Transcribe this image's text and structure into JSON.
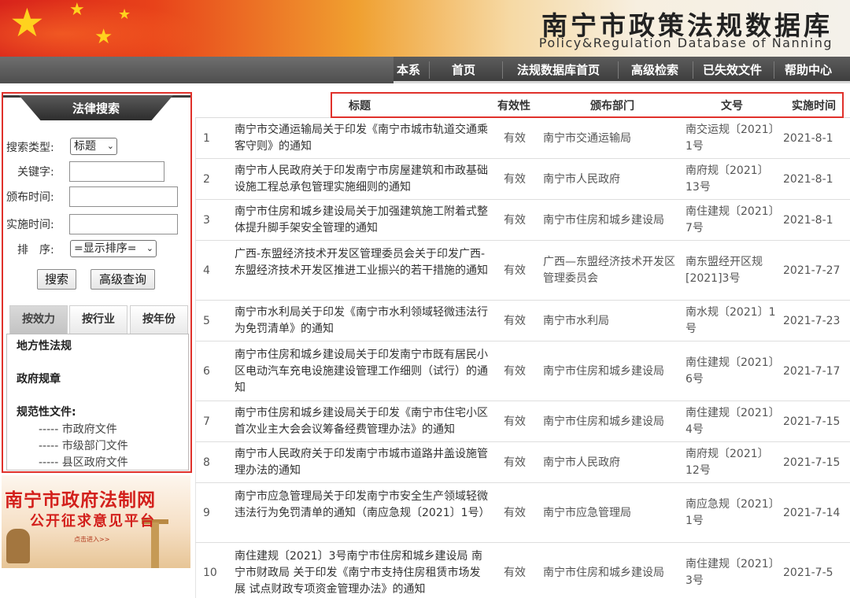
{
  "site": {
    "title": "南宁市政策法规数据库",
    "subtitle": "Policy&Regulation Database of Nanning"
  },
  "nav": {
    "partial": "本系",
    "items": [
      "首页",
      "法规数据库首页",
      "高级检索",
      "已失效文件",
      "帮助中心"
    ]
  },
  "search_panel": {
    "header": "法律搜索",
    "type_label": "搜索类型:",
    "type_value": "标题",
    "keyword_label": "关键字:",
    "keyword_value": "",
    "publish_label": "颁布时间:",
    "publish_value": "",
    "effective_label": "实施时间:",
    "effective_value": "",
    "sort_label": "排　序:",
    "sort_value": "=显示排序=",
    "search_button": "搜索",
    "advanced_button": "高级查询"
  },
  "tabs": [
    {
      "label": "按效力",
      "active": true
    },
    {
      "label": "按行业",
      "active": false
    },
    {
      "label": "按年份",
      "active": false
    }
  ],
  "categories": {
    "local_laws": "地方性法规",
    "gov_rules": "政府规章",
    "normative": "规范性文件:",
    "links": [
      "----- 市政府文件",
      "----- 市级部门文件",
      "----- 县区政府文件"
    ]
  },
  "promo": {
    "title": "南宁市政府法制网",
    "subtitle": "公开征求意见平台",
    "enter": "点击进入>>"
  },
  "table": {
    "headers": {
      "title": "标题",
      "validity": "有效性",
      "dept": "颁布部门",
      "doc_no": "文号",
      "date": "实施时间"
    },
    "rows": [
      {
        "idx": "1",
        "title": "南宁市交通运输局关于印发《南宁市城市轨道交通乘客守则》的通知",
        "validity": "有效",
        "dept": "南宁市交通运输局",
        "doc_no": "南交运规〔2021〕1号",
        "date": "2021-8-1"
      },
      {
        "idx": "2",
        "title": "南宁市人民政府关于印发南宁市房屋建筑和市政基础设施工程总承包管理实施细则的通知",
        "validity": "有效",
        "dept": "南宁市人民政府",
        "doc_no": "南府规〔2021〕13号",
        "date": "2021-8-1"
      },
      {
        "idx": "3",
        "title": "南宁市住房和城乡建设局关于加强建筑施工附着式整体提升脚手架安全管理的通知",
        "validity": "有效",
        "dept": "南宁市住房和城乡建设局",
        "doc_no": "南住建规〔2021〕7号",
        "date": "2021-8-1"
      },
      {
        "idx": "4",
        "title": "广西-东盟经济技术开发区管理委员会关于印发广西-东盟经济技术开发区推进工业振兴的若干措施的通知",
        "validity": "有效",
        "dept": "广西—东盟经济技术开发区管理委员会",
        "doc_no": "南东盟经开区规[2021]3号",
        "date": "2021-7-27"
      },
      {
        "idx": "5",
        "title": "南宁市水利局关于印发《南宁市水利领域轻微违法行为免罚清单》的通知",
        "validity": "有效",
        "dept": "南宁市水利局",
        "doc_no": "南水规〔2021〕1号",
        "date": "2021-7-23"
      },
      {
        "idx": "6",
        "title": "南宁市住房和城乡建设局关于印发南宁市既有居民小区电动汽车充电设施建设管理工作细则（试行）的通知",
        "validity": "有效",
        "dept": "南宁市住房和城乡建设局",
        "doc_no": "南住建规〔2021〕6号",
        "date": "2021-7-17"
      },
      {
        "idx": "7",
        "title": "南宁市住房和城乡建设局关于印发《南宁市住宅小区首次业主大会会议筹备经费管理办法》的通知",
        "validity": "有效",
        "dept": "南宁市住房和城乡建设局",
        "doc_no": "南住建规〔2021〕4号",
        "date": "2021-7-15"
      },
      {
        "idx": "8",
        "title": "南宁市人民政府关于印发南宁市城市道路井盖设施管理办法的通知",
        "validity": "有效",
        "dept": "南宁市人民政府",
        "doc_no": "南府规〔2021〕12号",
        "date": "2021-7-15"
      },
      {
        "idx": "9",
        "title": "南宁市应急管理局关于印发南宁市安全生产领域轻微违法行为免罚清单的通知（南应急规〔2021〕1号）",
        "validity": "有效",
        "dept": "南宁市应急管理局",
        "doc_no": "南应急规〔2021〕1号",
        "date": "2021-7-14"
      },
      {
        "idx": "10",
        "title": "南住建规〔2021〕3号南宁市住房和城乡建设局 南宁市财政局 关于印发《南宁市支持住房租赁市场发展 试点财政专项资金管理办法》的通知",
        "validity": "有效",
        "dept": "南宁市住房和城乡建设局",
        "doc_no": "南住建规〔2021〕3号",
        "date": "2021-7-5"
      }
    ]
  }
}
